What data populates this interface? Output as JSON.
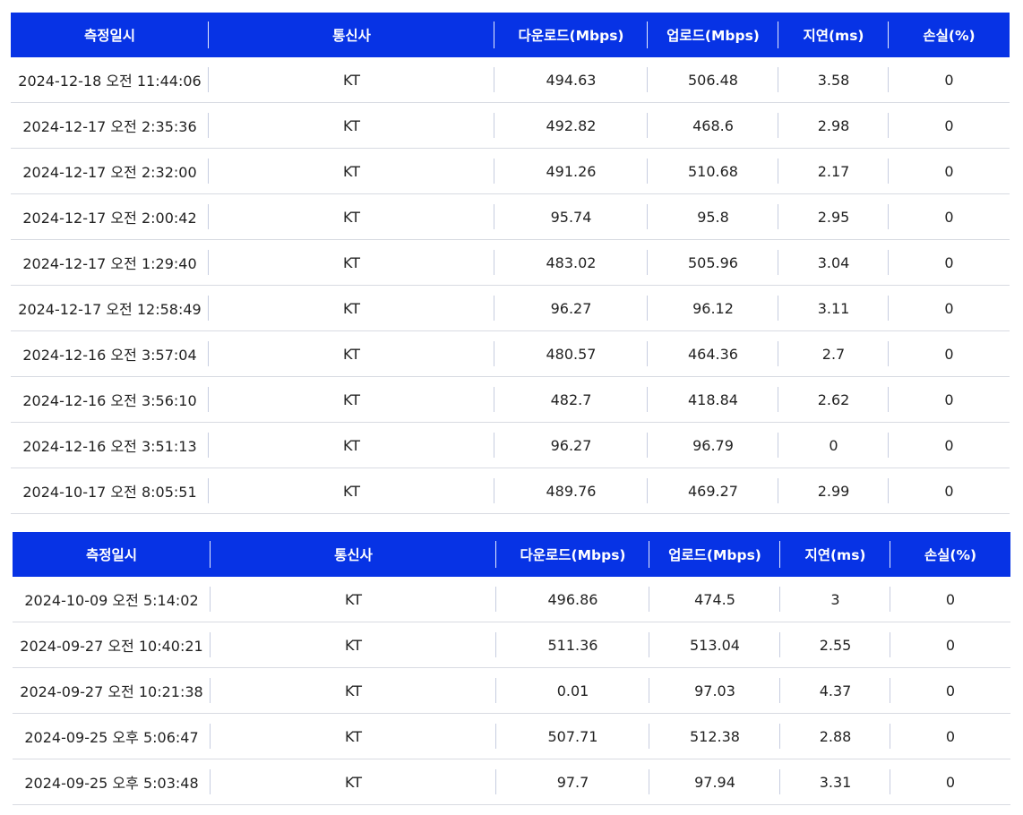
{
  "headers": [
    "측정일시",
    "통신사",
    "다운로드(Mbps)",
    "업로드(Mbps)",
    "지연(ms)",
    "손실(%)"
  ],
  "tables": [
    {
      "rows": [
        [
          "2024-12-18 오전 11:44:06",
          "KT",
          "494.63",
          "506.48",
          "3.58",
          "0"
        ],
        [
          "2024-12-17 오전 2:35:36",
          "KT",
          "492.82",
          "468.6",
          "2.98",
          "0"
        ],
        [
          "2024-12-17 오전 2:32:00",
          "KT",
          "491.26",
          "510.68",
          "2.17",
          "0"
        ],
        [
          "2024-12-17 오전 2:00:42",
          "KT",
          "95.74",
          "95.8",
          "2.95",
          "0"
        ],
        [
          "2024-12-17 오전 1:29:40",
          "KT",
          "483.02",
          "505.96",
          "3.04",
          "0"
        ],
        [
          "2024-12-17 오전 12:58:49",
          "KT",
          "96.27",
          "96.12",
          "3.11",
          "0"
        ],
        [
          "2024-12-16 오전 3:57:04",
          "KT",
          "480.57",
          "464.36",
          "2.7",
          "0"
        ],
        [
          "2024-12-16 오전 3:56:10",
          "KT",
          "482.7",
          "418.84",
          "2.62",
          "0"
        ],
        [
          "2024-12-16 오전 3:51:13",
          "KT",
          "96.27",
          "96.79",
          "0",
          "0"
        ],
        [
          "2024-10-17 오전 8:05:51",
          "KT",
          "489.76",
          "469.27",
          "2.99",
          "0"
        ]
      ]
    },
    {
      "rows": [
        [
          "2024-10-09 오전 5:14:02",
          "KT",
          "496.86",
          "474.5",
          "3",
          "0"
        ],
        [
          "2024-09-27 오전 10:40:21",
          "KT",
          "511.36",
          "513.04",
          "2.55",
          "0"
        ],
        [
          "2024-09-27 오전 10:21:38",
          "KT",
          "0.01",
          "97.03",
          "4.37",
          "0"
        ],
        [
          "2024-09-25 오후 5:06:47",
          "KT",
          "507.71",
          "512.38",
          "2.88",
          "0"
        ],
        [
          "2024-09-25 오후 5:03:48",
          "KT",
          "97.7",
          "97.94",
          "3.31",
          "0"
        ]
      ]
    }
  ],
  "colors": {
    "header_bg": "#0733e5",
    "header_text": "#ffffff",
    "row_divider": "#d8dbe2"
  }
}
